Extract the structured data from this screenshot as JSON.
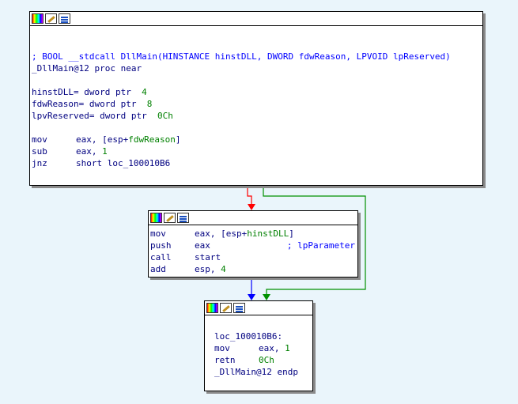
{
  "edge_colors": {
    "true": "#ff0000",
    "false": "#009000",
    "uncond": "#0000ff"
  },
  "block1": {
    "comment": "; BOOL __stdcall DllMain(HINSTANCE hinstDLL, DWORD fdwReason, LPVOID lpReserved)",
    "proc_line": "_DllMain@12 proc near",
    "args": [
      {
        "name": "hinstDLL",
        "decl": "= dword ptr  ",
        "value": "4"
      },
      {
        "name": "fdwReason",
        "decl": "= dword ptr  ",
        "value": "8"
      },
      {
        "name": "lpvReserved",
        "decl": "= dword ptr  ",
        "value": "0Ch"
      }
    ],
    "i1": {
      "mnem": "mov",
      "op_pre": "eax, [esp+",
      "op_var": "fdwReason",
      "op_post": "]"
    },
    "i2": {
      "mnem": "sub",
      "op_pre": "eax, ",
      "op_num": "1"
    },
    "i3": {
      "mnem": "jnz",
      "op_pre": "short loc_100010B6"
    }
  },
  "block2": {
    "i1": {
      "mnem": "mov",
      "op_pre": "eax, [esp+",
      "op_var": "hinstDLL",
      "op_post": "]"
    },
    "i2": {
      "mnem": "push",
      "op_pre": "eax",
      "comment": "; lpParameter"
    },
    "i3": {
      "mnem": "call",
      "op_pre": "start"
    },
    "i4": {
      "mnem": "add",
      "op_pre": "esp, ",
      "op_num": "4"
    }
  },
  "block3": {
    "label": "loc_100010B6:",
    "i1": {
      "mnem": "mov",
      "op_pre": "eax, ",
      "op_num": "1"
    },
    "i2": {
      "mnem": "retn",
      "op_pre": "",
      "op_num": "0Ch"
    },
    "endp": "_DllMain@12 endp"
  }
}
